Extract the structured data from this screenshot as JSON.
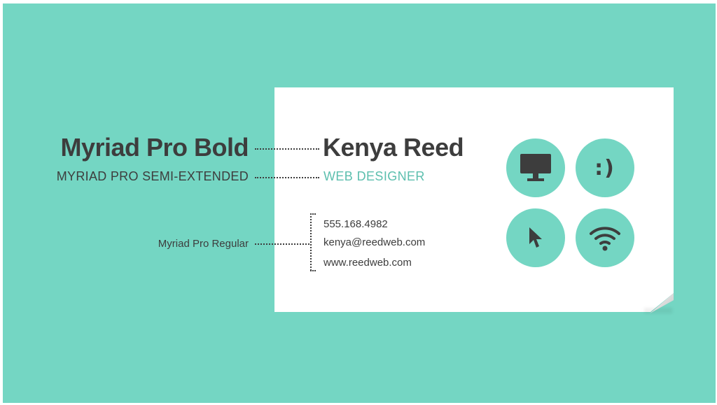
{
  "labels": {
    "bold": "Myriad Pro Bold",
    "semi_extended": "MYRIAD PRO SEMI-EXTENDED",
    "regular": "Myriad Pro Regular"
  },
  "card": {
    "name": "Kenya Reed",
    "title": "WEB DESIGNER",
    "phone": "555.168.4982",
    "email": "kenya@reedweb.com",
    "website": "www.reedweb.com",
    "icons": [
      "monitor-icon",
      "smiley-icon",
      "cursor-icon",
      "wifi-icon"
    ],
    "smiley_text": ":)"
  },
  "colors": {
    "background": "#74d6c3",
    "card": "#ffffff",
    "text_dark": "#3d3d3d",
    "accent": "#5cbfae"
  }
}
